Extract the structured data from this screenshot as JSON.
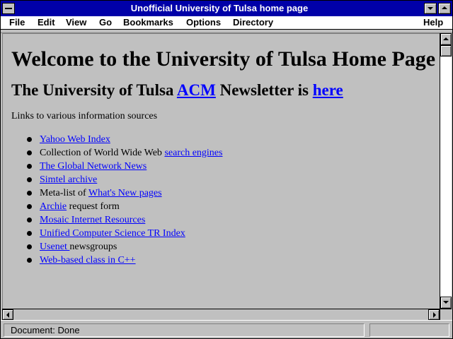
{
  "window": {
    "title": "Unofficial University of Tulsa home page"
  },
  "menubar": {
    "file": "File",
    "edit": "Edit",
    "view": "View",
    "go": "Go",
    "bookmarks": "Bookmarks",
    "options": "Options",
    "directory": "Directory",
    "help": "Help"
  },
  "page": {
    "heading": "Welcome to the University of Tulsa Home Page",
    "newsletter": {
      "prefix": "The University of Tulsa ",
      "acm_link": "ACM",
      "middle": " Newsletter is ",
      "here_link": "here"
    },
    "intro": "Links to various information sources",
    "links": [
      {
        "before": "",
        "link": "Yahoo Web Index",
        "after": ""
      },
      {
        "before": "Collection of World Wide Web ",
        "link": "search engines",
        "after": ""
      },
      {
        "before": "",
        "link": "The Global Network News",
        "after": ""
      },
      {
        "before": "",
        "link": "Simtel archive",
        "after": ""
      },
      {
        "before": "Meta-list of ",
        "link": "What's New pages",
        "after": ""
      },
      {
        "before": "",
        "link": "Archie",
        "after": " request form"
      },
      {
        "before": "",
        "link": "Mosaic Internet Resources",
        "after": ""
      },
      {
        "before": "",
        "link": "Unified Computer Science TR Index",
        "after": ""
      },
      {
        "before": "",
        "link": "Usenet ",
        "after": "newsgroups"
      },
      {
        "before": "",
        "link": "Web-based class in C++",
        "after": ""
      }
    ]
  },
  "status": {
    "text": "Document: Done"
  },
  "colors": {
    "titlebar": "#0000a8",
    "link": "#0000ff",
    "background": "#c0c0c0"
  }
}
